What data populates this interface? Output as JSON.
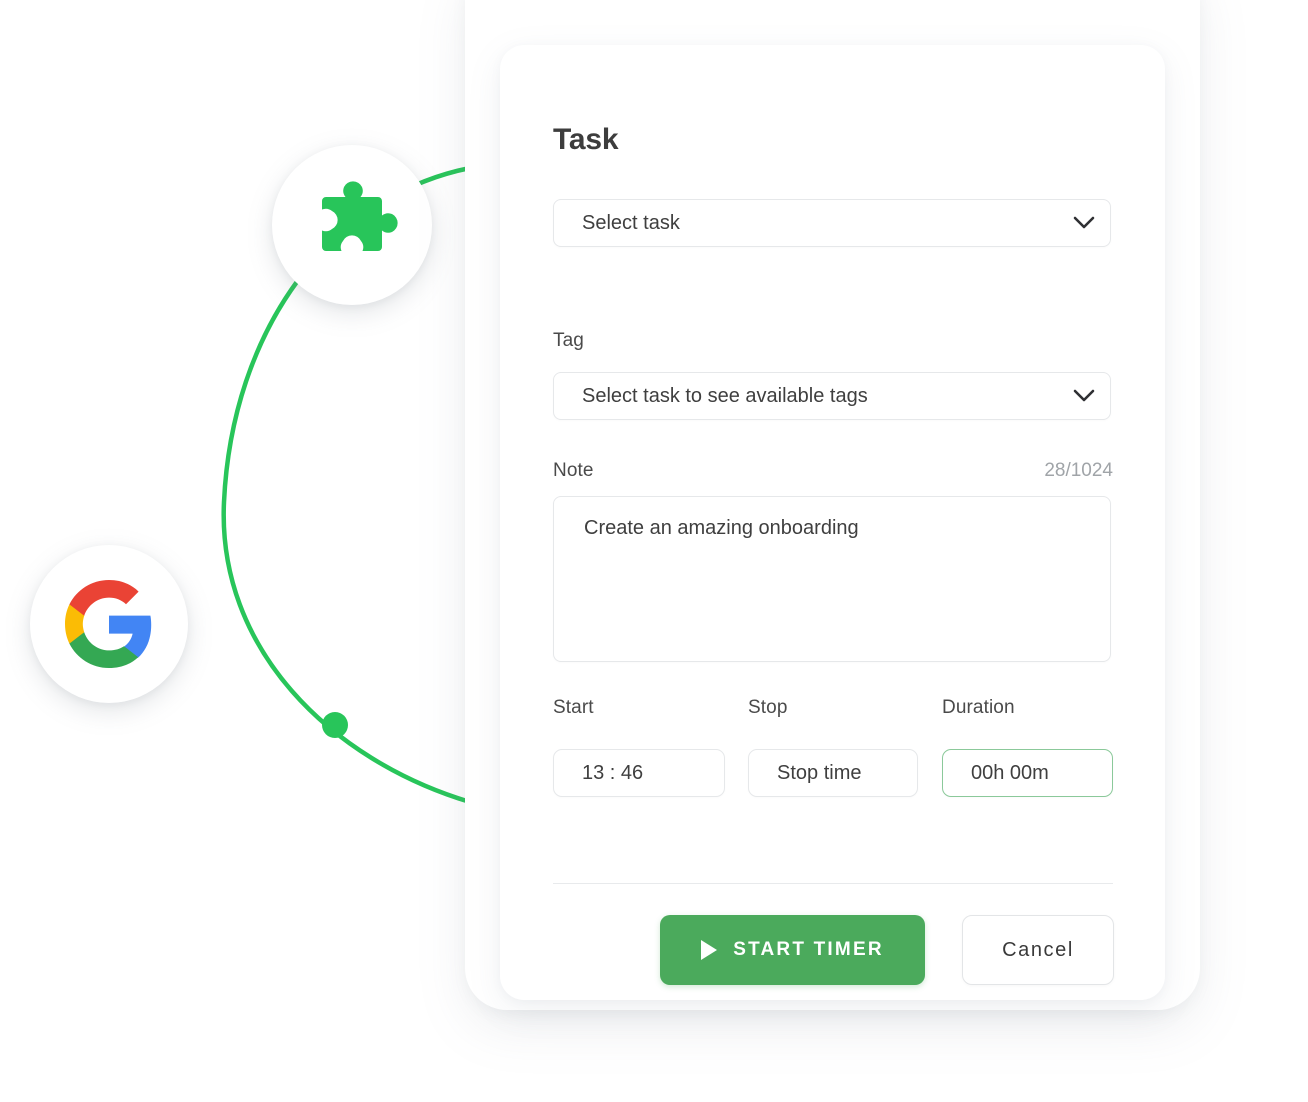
{
  "decor": {
    "curve_color": "#28c55a",
    "dot_color": "#28c55a",
    "puzzle_color": "#28c55a",
    "google_colors": {
      "red": "#ea4335",
      "yellow": "#fbbc05",
      "green": "#34a853",
      "blue": "#4285f4"
    }
  },
  "card": {
    "title": "Task",
    "accent_color": "#4baa5c",
    "task": {
      "label": "Task",
      "value": "Select task",
      "icon": "chevron-down-icon"
    },
    "tag": {
      "label": "Tag",
      "value": "Select task to see available tags",
      "icon": "chevron-down-icon"
    },
    "note": {
      "label": "Note",
      "counter": "28/1024",
      "value": "Create an amazing onboarding"
    },
    "time": {
      "start": {
        "label": "Start",
        "value": "13 : 46"
      },
      "stop": {
        "label": "Stop",
        "value": "Stop time"
      },
      "duration": {
        "label": "Duration",
        "value": "00h 00m",
        "border_color": "#8bc99a"
      }
    },
    "actions": {
      "start_timer_label": "START TIMER",
      "start_timer_icon": "play-icon",
      "cancel_label": "Cancel"
    }
  }
}
